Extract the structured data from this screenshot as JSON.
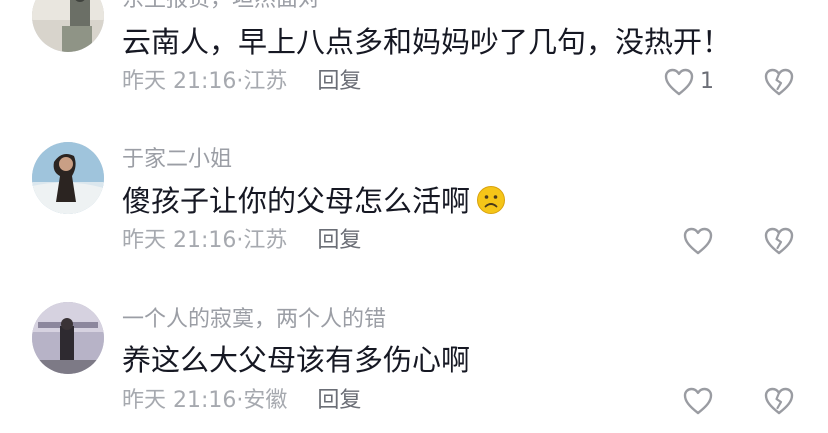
{
  "comments": [
    {
      "username": "东土报贯，坦然面对",
      "text": "云南人，早上八点多和妈妈吵了几句，没热开！",
      "time": "昨天 21:16",
      "separator": "·",
      "location": "江苏",
      "reply_label": "回复",
      "like_count": "1",
      "emoji": ""
    },
    {
      "username": "于家二小姐",
      "text": "傻孩子让你的父母怎么活啊",
      "time": "昨天 21:16",
      "separator": "·",
      "location": "江苏",
      "reply_label": "回复",
      "like_count": "",
      "emoji": "sad-face"
    },
    {
      "username": "一个人的寂寞，两个人的错",
      "text": "养这么大父母该有多伤心啊",
      "time": "昨天 21:16",
      "separator": "·",
      "location": "安徽",
      "reply_label": "回复",
      "like_count": "",
      "emoji": ""
    }
  ],
  "colors": {
    "background": "#ffffff",
    "text": "#161823",
    "username": "#9b9ea5",
    "meta": "#a6a9af",
    "icon": "#9a9ca2",
    "emoji_fill": "#f5c518"
  },
  "icons": {
    "like": "heart-outline-icon",
    "dislike": "broken-heart-icon",
    "emoji": "sad-face-emoji"
  }
}
